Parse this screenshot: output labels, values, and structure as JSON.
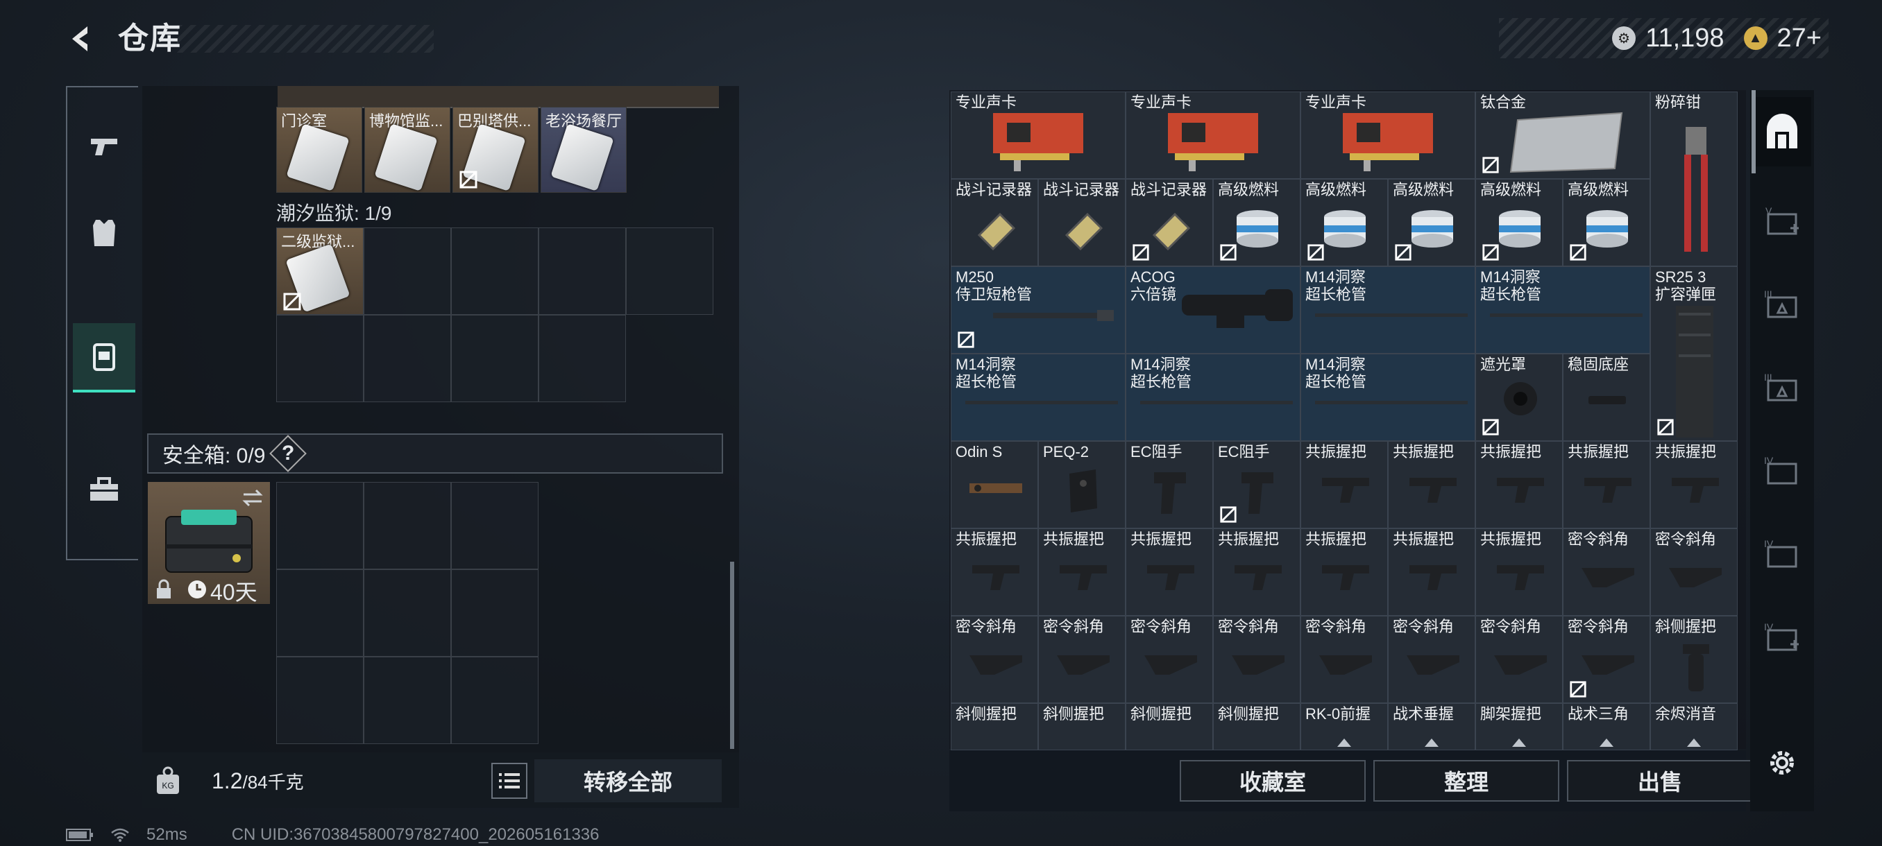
{
  "header": {
    "title": "仓库",
    "currency_silver": "11,198",
    "currency_gold": "27+"
  },
  "left_nav": [
    "weapons",
    "armor",
    "backpack",
    "toolbox"
  ],
  "left_panel": {
    "key_tiles": [
      {
        "label": "门诊室",
        "no_insure": false
      },
      {
        "label": "博物馆监...",
        "no_insure": false
      },
      {
        "label": "巴别塔供...",
        "no_insure": true
      },
      {
        "label": "老浴场餐厅",
        "no_insure": false
      }
    ],
    "prison_label": "潮汐监狱: 1/9",
    "prison_tile_label": "二级监狱...",
    "safe_label": "安全箱: 0/9",
    "help_label": "?",
    "safe_box_timer": "40天",
    "weight_current": "1.2",
    "weight_max": "/84千克",
    "transfer_all": "转移全部"
  },
  "status_bar": {
    "ping": "52ms",
    "uid": "CN UID:3670384580079782​7400_202605161336"
  },
  "inventory": {
    "row1": [
      "专业声卡",
      "专业声卡",
      "专业声卡",
      "钛合金",
      "粉碎钳"
    ],
    "row2": [
      "战斗记录器",
      "战斗记录器",
      "战斗记录器",
      "高级燃料",
      "高级燃料",
      "高级燃料",
      "高级燃料",
      "高级燃料"
    ],
    "row3": [
      "M250\n侍卫短枪管",
      "ACOG\n六倍镜",
      "M14洞察\n超长枪管",
      "M14洞察\n超长枪管",
      "SR25 3\n扩容弹匣"
    ],
    "row4": [
      "M14洞察\n超长枪管",
      "M14洞察\n超长枪管",
      "M14洞察\n超长枪管",
      "遮光罩",
      "稳固底座"
    ],
    "row5": [
      "Odin S",
      "PEQ-2",
      "EC阻手",
      "EC阻手",
      "共振握把",
      "共振握把",
      "共振握把",
      "共振握把",
      "共振握把"
    ],
    "row6": [
      "共振握把",
      "共振握把",
      "共振握把",
      "共振握把",
      "共振握把",
      "共振握把",
      "共振握把",
      "密令斜角",
      "密令斜角"
    ],
    "row7": [
      "密令斜角",
      "密令斜角",
      "密令斜角",
      "密令斜角",
      "密令斜角",
      "密令斜角",
      "密令斜角",
      "密令斜角",
      "斜侧握把"
    ],
    "row8": [
      "斜侧握把",
      "斜侧握把",
      "斜侧握把",
      "斜侧握把",
      "RK-0前握",
      "战术垂握",
      "脚架握把",
      "战术三角",
      "余烬消音"
    ]
  },
  "actions": {
    "collection": "收藏室",
    "organize": "整理",
    "sell": "出售"
  },
  "right_nav": [
    "vault-main",
    "V-room",
    "III-room",
    "III-room-2",
    "IV-room",
    "IV-room-2",
    "IV-room-add",
    "settings"
  ]
}
